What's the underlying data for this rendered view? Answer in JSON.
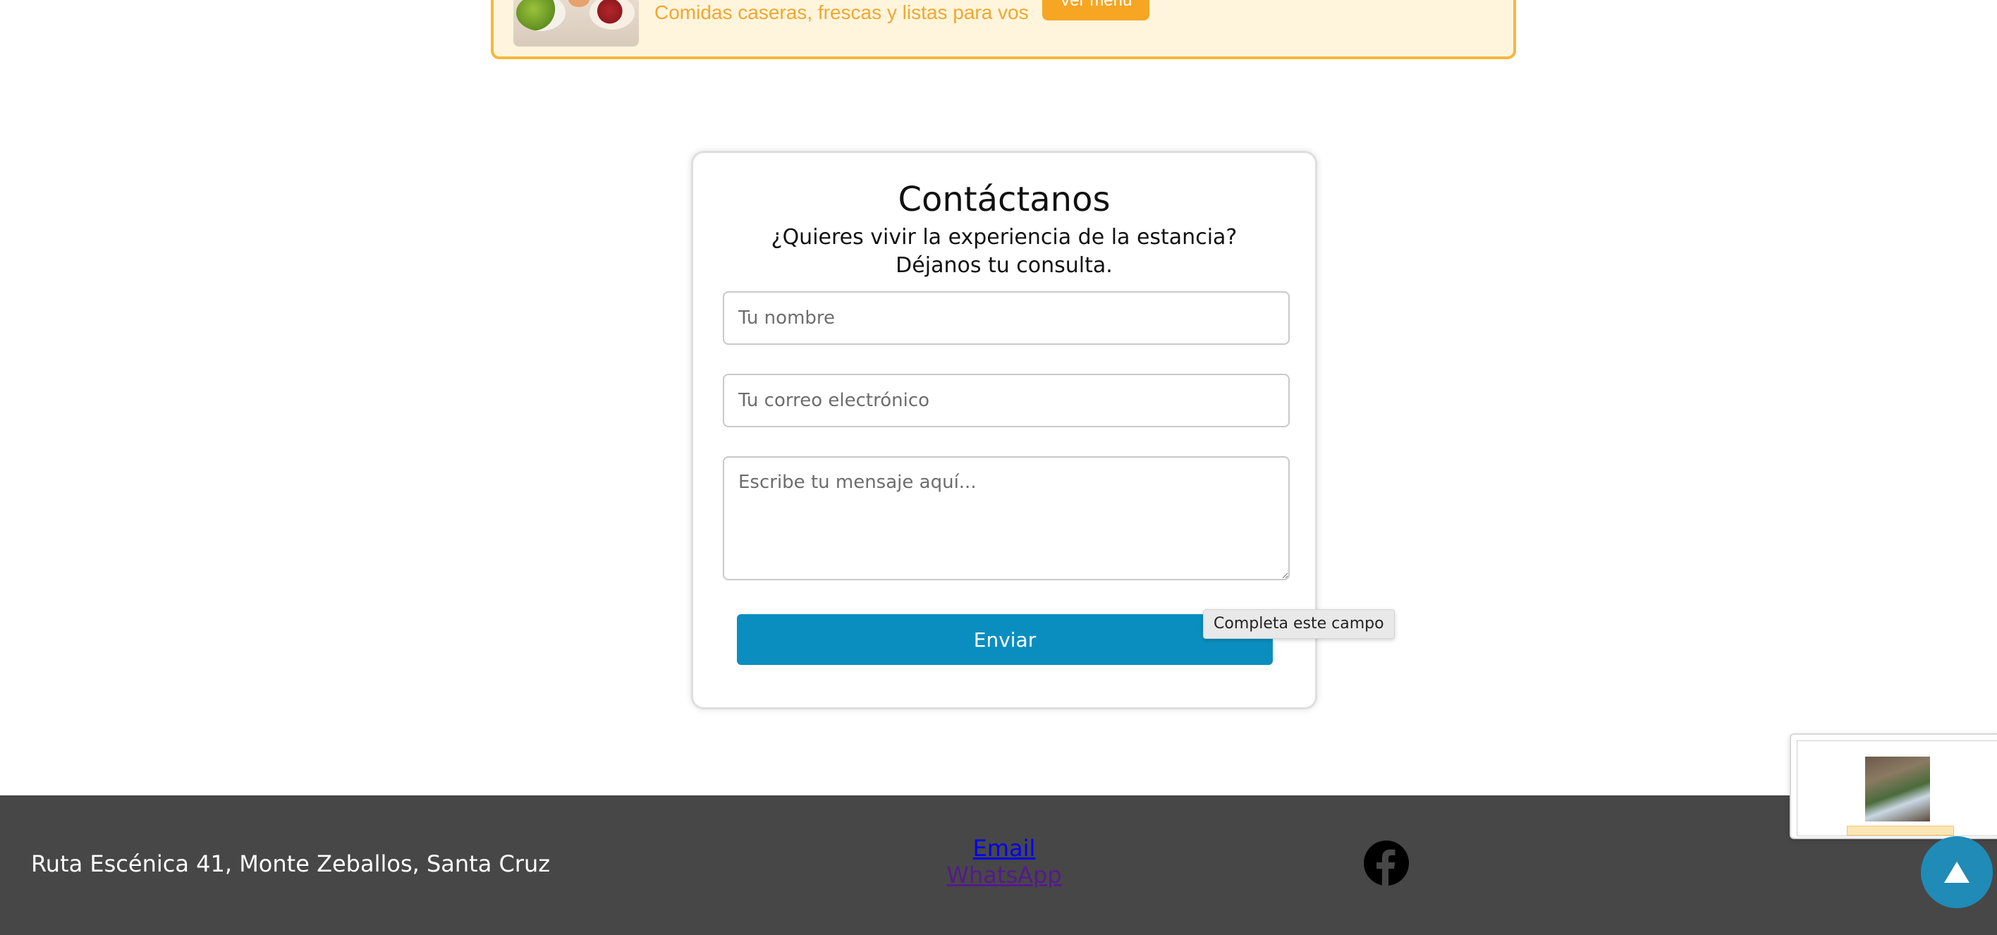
{
  "promo": {
    "text": "Comidas caseras, frescas y listas para vos",
    "button_label": "Ver menú",
    "image_icon": "food-photo"
  },
  "contact": {
    "title": "Contáctanos",
    "subtitle_line1": "¿Quieres vivir la experiencia de la estancia?",
    "subtitle_line2": "Déjanos tu consulta.",
    "name_placeholder": "Tu nombre",
    "email_placeholder": "Tu correo electrónico",
    "message_placeholder": "Escribe tu mensaje aquí...",
    "submit_label": "Enviar",
    "validation_tooltip": "Completa este campo"
  },
  "footer": {
    "address": "Ruta Escénica 41, Monte Zeballos, Santa Cruz",
    "email_link": "Email",
    "whatsapp_link": "WhatsApp",
    "social_icon": "facebook-icon"
  },
  "widgets": {
    "scroll_top_icon": "arrow-up-icon",
    "preview_icon": "page-preview-thumbnail"
  },
  "colors": {
    "accent": "#0a8ec0",
    "promo_bg": "#fff5dd",
    "promo_border": "#f6b73c",
    "promo_text": "#f2a72e",
    "footer_bg": "#474747",
    "scroll_top": "#1f8bb6"
  }
}
